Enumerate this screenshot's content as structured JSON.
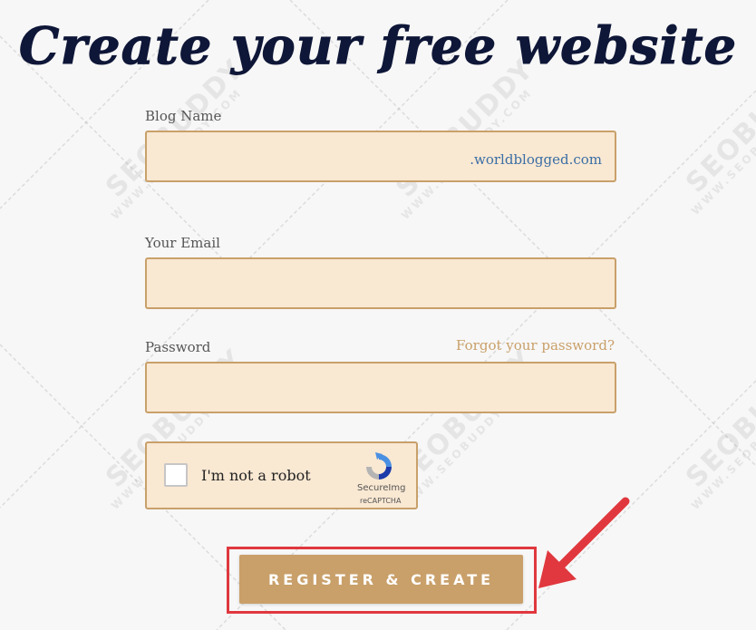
{
  "page": {
    "title": "Create your free website"
  },
  "form": {
    "blog_name_label": "Blog Name",
    "blog_name_value": "",
    "blog_name_suffix": ".worldblogged.com",
    "email_label": "Your Email",
    "email_value": "",
    "password_label": "Password",
    "password_value": "",
    "forgot_password": "Forgot your password?",
    "submit_label": "REGISTER & CREATE"
  },
  "captcha": {
    "label": "I'm not a robot",
    "checked": false,
    "brand": "SecureImg",
    "sub": "reCAPTCHA"
  },
  "watermark": {
    "brand": "SEOBUDDY",
    "site": "WWW.SEOBUDDY.COM"
  },
  "colors": {
    "title": "#0f1738",
    "field_bg": "#f9e8d2",
    "field_border": "#c9a06a",
    "button_bg": "#c9a06a",
    "suffix_text": "#3a6ea5",
    "highlight": "#e0383e"
  },
  "icons": {
    "captcha_logo": "recaptcha-icon",
    "annotation": "arrow-icon"
  }
}
